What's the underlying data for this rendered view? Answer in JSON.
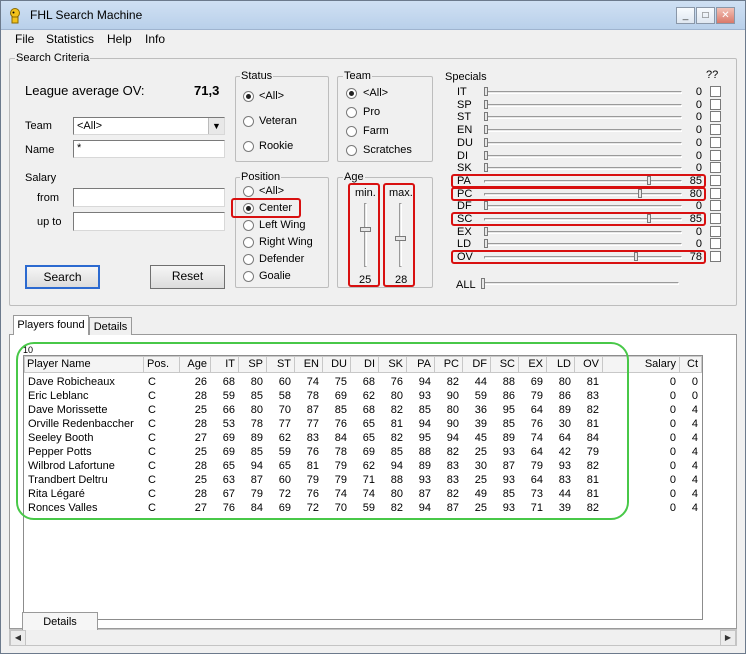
{
  "window": {
    "title": "FHL Search Machine",
    "min": "_",
    "max": "□",
    "close": "✕"
  },
  "menu": [
    "File",
    "Statistics",
    "Help",
    "Info"
  ],
  "criteria": {
    "group_label": "Search Criteria",
    "league_avg_label": "League average OV:",
    "league_avg_value": "71,3",
    "team_label": "Team",
    "team_value": "<All>",
    "name_label": "Name",
    "name_value": "*",
    "salary_label": "Salary",
    "from_label": "from",
    "upto_label": "up to",
    "from_value": "",
    "upto_value": "",
    "search_button": "Search",
    "reset_button": "Reset"
  },
  "status": {
    "label": "Status",
    "options": [
      "<All>",
      "Veteran",
      "Rookie"
    ],
    "selected": 0
  },
  "team_group": {
    "label": "Team",
    "options": [
      "<All>",
      "Pro",
      "Farm",
      "Scratches"
    ],
    "selected": 0
  },
  "position": {
    "label": "Position",
    "options": [
      "<All>",
      "Center",
      "Left Wing",
      "Right Wing",
      "Defender",
      "Goalie"
    ],
    "selected": 1
  },
  "age": {
    "label": "Age",
    "min_label": "min.",
    "max_label": "max.",
    "min_value": "25",
    "max_value": "28",
    "min_fraction": 0.4,
    "max_fraction": 0.55
  },
  "specials": {
    "label": "Specials",
    "help": "??",
    "items": [
      {
        "name": "IT",
        "value": "0",
        "level": 0,
        "highlight": false
      },
      {
        "name": "SP",
        "value": "0",
        "level": 0,
        "highlight": false
      },
      {
        "name": "ST",
        "value": "0",
        "level": 0,
        "highlight": false
      },
      {
        "name": "EN",
        "value": "0",
        "level": 0,
        "highlight": false
      },
      {
        "name": "DU",
        "value": "0",
        "level": 0,
        "highlight": false
      },
      {
        "name": "DI",
        "value": "0",
        "level": 0,
        "highlight": false
      },
      {
        "name": "SK",
        "value": "0",
        "level": 0,
        "highlight": false
      },
      {
        "name": "PA",
        "value": "85",
        "level": 0.85,
        "highlight": true
      },
      {
        "name": "PC",
        "value": "80",
        "level": 0.8,
        "highlight": true
      },
      {
        "name": "DF",
        "value": "0",
        "level": 0,
        "highlight": false
      },
      {
        "name": "SC",
        "value": "85",
        "level": 0.85,
        "highlight": true
      },
      {
        "name": "EX",
        "value": "0",
        "level": 0,
        "highlight": false
      },
      {
        "name": "LD",
        "value": "0",
        "level": 0,
        "highlight": false
      },
      {
        "name": "OV",
        "value": "78",
        "level": 0.78,
        "highlight": true
      }
    ],
    "all_label": "ALL"
  },
  "tabs": {
    "players_found": "Players found",
    "details": "Details",
    "bottom_details": "Details"
  },
  "result_count": "10",
  "table": {
    "columns": [
      "Player Name",
      "Pos.",
      "Age",
      "IT",
      "SP",
      "ST",
      "EN",
      "DU",
      "DI",
      "SK",
      "PA",
      "PC",
      "DF",
      "SC",
      "EX",
      "LD",
      "OV",
      "Salary",
      "Ct"
    ],
    "rows": [
      [
        "Dave Robicheaux",
        "C",
        "26",
        "68",
        "80",
        "60",
        "74",
        "75",
        "68",
        "76",
        "94",
        "82",
        "44",
        "88",
        "69",
        "80",
        "81",
        "0",
        "0"
      ],
      [
        "Eric Leblanc",
        "C",
        "28",
        "59",
        "85",
        "58",
        "78",
        "69",
        "62",
        "80",
        "93",
        "90",
        "59",
        "86",
        "79",
        "86",
        "83",
        "0",
        "0"
      ],
      [
        "Dave Morissette",
        "C",
        "25",
        "66",
        "80",
        "70",
        "87",
        "85",
        "68",
        "82",
        "85",
        "80",
        "36",
        "95",
        "64",
        "89",
        "82",
        "0",
        "4"
      ],
      [
        "Orville Redenbaccher",
        "C",
        "28",
        "53",
        "78",
        "77",
        "77",
        "76",
        "65",
        "81",
        "94",
        "90",
        "39",
        "85",
        "76",
        "30",
        "81",
        "0",
        "4"
      ],
      [
        "Seeley Booth",
        "C",
        "27",
        "69",
        "89",
        "62",
        "83",
        "84",
        "65",
        "82",
        "95",
        "94",
        "45",
        "89",
        "74",
        "64",
        "84",
        "0",
        "4"
      ],
      [
        "Pepper Potts",
        "C",
        "25",
        "69",
        "85",
        "59",
        "76",
        "78",
        "69",
        "85",
        "88",
        "82",
        "25",
        "93",
        "64",
        "42",
        "79",
        "0",
        "4"
      ],
      [
        "Wilbrod Lafortune",
        "C",
        "28",
        "65",
        "94",
        "65",
        "81",
        "79",
        "62",
        "94",
        "89",
        "83",
        "30",
        "87",
        "79",
        "93",
        "82",
        "0",
        "4"
      ],
      [
        "Trandbert Deltru",
        "C",
        "25",
        "63",
        "87",
        "60",
        "79",
        "79",
        "71",
        "88",
        "93",
        "83",
        "25",
        "93",
        "64",
        "83",
        "81",
        "0",
        "4"
      ],
      [
        "Rita Légaré",
        "C",
        "28",
        "67",
        "79",
        "72",
        "76",
        "74",
        "74",
        "80",
        "87",
        "82",
        "49",
        "85",
        "73",
        "44",
        "81",
        "0",
        "4"
      ],
      [
        "Ronces Valles",
        "C",
        "27",
        "76",
        "84",
        "69",
        "72",
        "70",
        "59",
        "82",
        "94",
        "87",
        "25",
        "93",
        "71",
        "39",
        "82",
        "0",
        "4"
      ]
    ]
  }
}
